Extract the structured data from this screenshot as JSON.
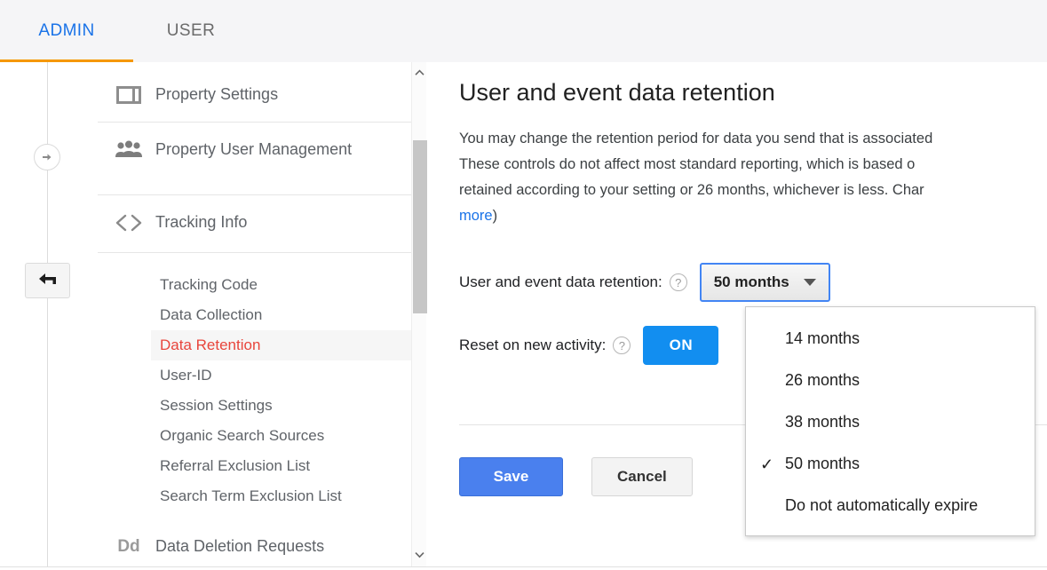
{
  "header": {
    "tabs": [
      {
        "label": "ADMIN",
        "active": true
      },
      {
        "label": "USER",
        "active": false
      }
    ]
  },
  "rail": {
    "expand_icon": "arrow-right-circle-icon",
    "back_icon": "arrow-left-icon"
  },
  "sidebar": {
    "items": [
      {
        "label": "Property Settings",
        "icon": "web-layout-icon"
      },
      {
        "label": "Property User Management",
        "icon": "people-group-icon"
      },
      {
        "label": "Tracking Info",
        "icon": "code-brackets-icon"
      }
    ],
    "sub_items": [
      {
        "label": "Tracking Code",
        "selected": false
      },
      {
        "label": "Data Collection",
        "selected": false
      },
      {
        "label": "Data Retention",
        "selected": true
      },
      {
        "label": "User-ID",
        "selected": false
      },
      {
        "label": "Session Settings",
        "selected": false
      },
      {
        "label": "Organic Search Sources",
        "selected": false
      },
      {
        "label": "Referral Exclusion List",
        "selected": false
      },
      {
        "label": "Search Term Exclusion List",
        "selected": false
      }
    ],
    "footer_item": {
      "label": "Data Deletion Requests",
      "icon": "dd-text-icon"
    },
    "selected_color": "#e8453c"
  },
  "scrollbar": {
    "up_icon": "chevron-up-icon",
    "down_icon": "chevron-down-icon"
  },
  "main": {
    "title": "User and event data retention",
    "paragraph_lines": [
      "You may change the retention period for data you send that is associated",
      "These controls do not affect most standard reporting, which is based o",
      "retained according to your setting or 26 months, whichever is less. Char"
    ],
    "paragraph_link": "more",
    "paragraph_tail": ")",
    "retention_row": {
      "label": "User and event data retention:",
      "help_icon": "help-circle-icon",
      "value": "50 months",
      "caret_icon": "caret-down-icon"
    },
    "reset_row": {
      "label": "Reset on new activity:",
      "help_icon": "help-circle-icon",
      "toggle_value": "ON",
      "toggle_color": "#128ef0"
    },
    "buttons": {
      "save": "Save",
      "cancel": "Cancel",
      "save_color": "#4a80ee"
    }
  },
  "dropdown_menu": {
    "check_glyph": "✓",
    "options": [
      {
        "label": "14 months",
        "checked": false
      },
      {
        "label": "26 months",
        "checked": false
      },
      {
        "label": "38 months",
        "checked": false
      },
      {
        "label": "50 months",
        "checked": true
      },
      {
        "label": "Do not automatically expire",
        "checked": false
      }
    ]
  }
}
